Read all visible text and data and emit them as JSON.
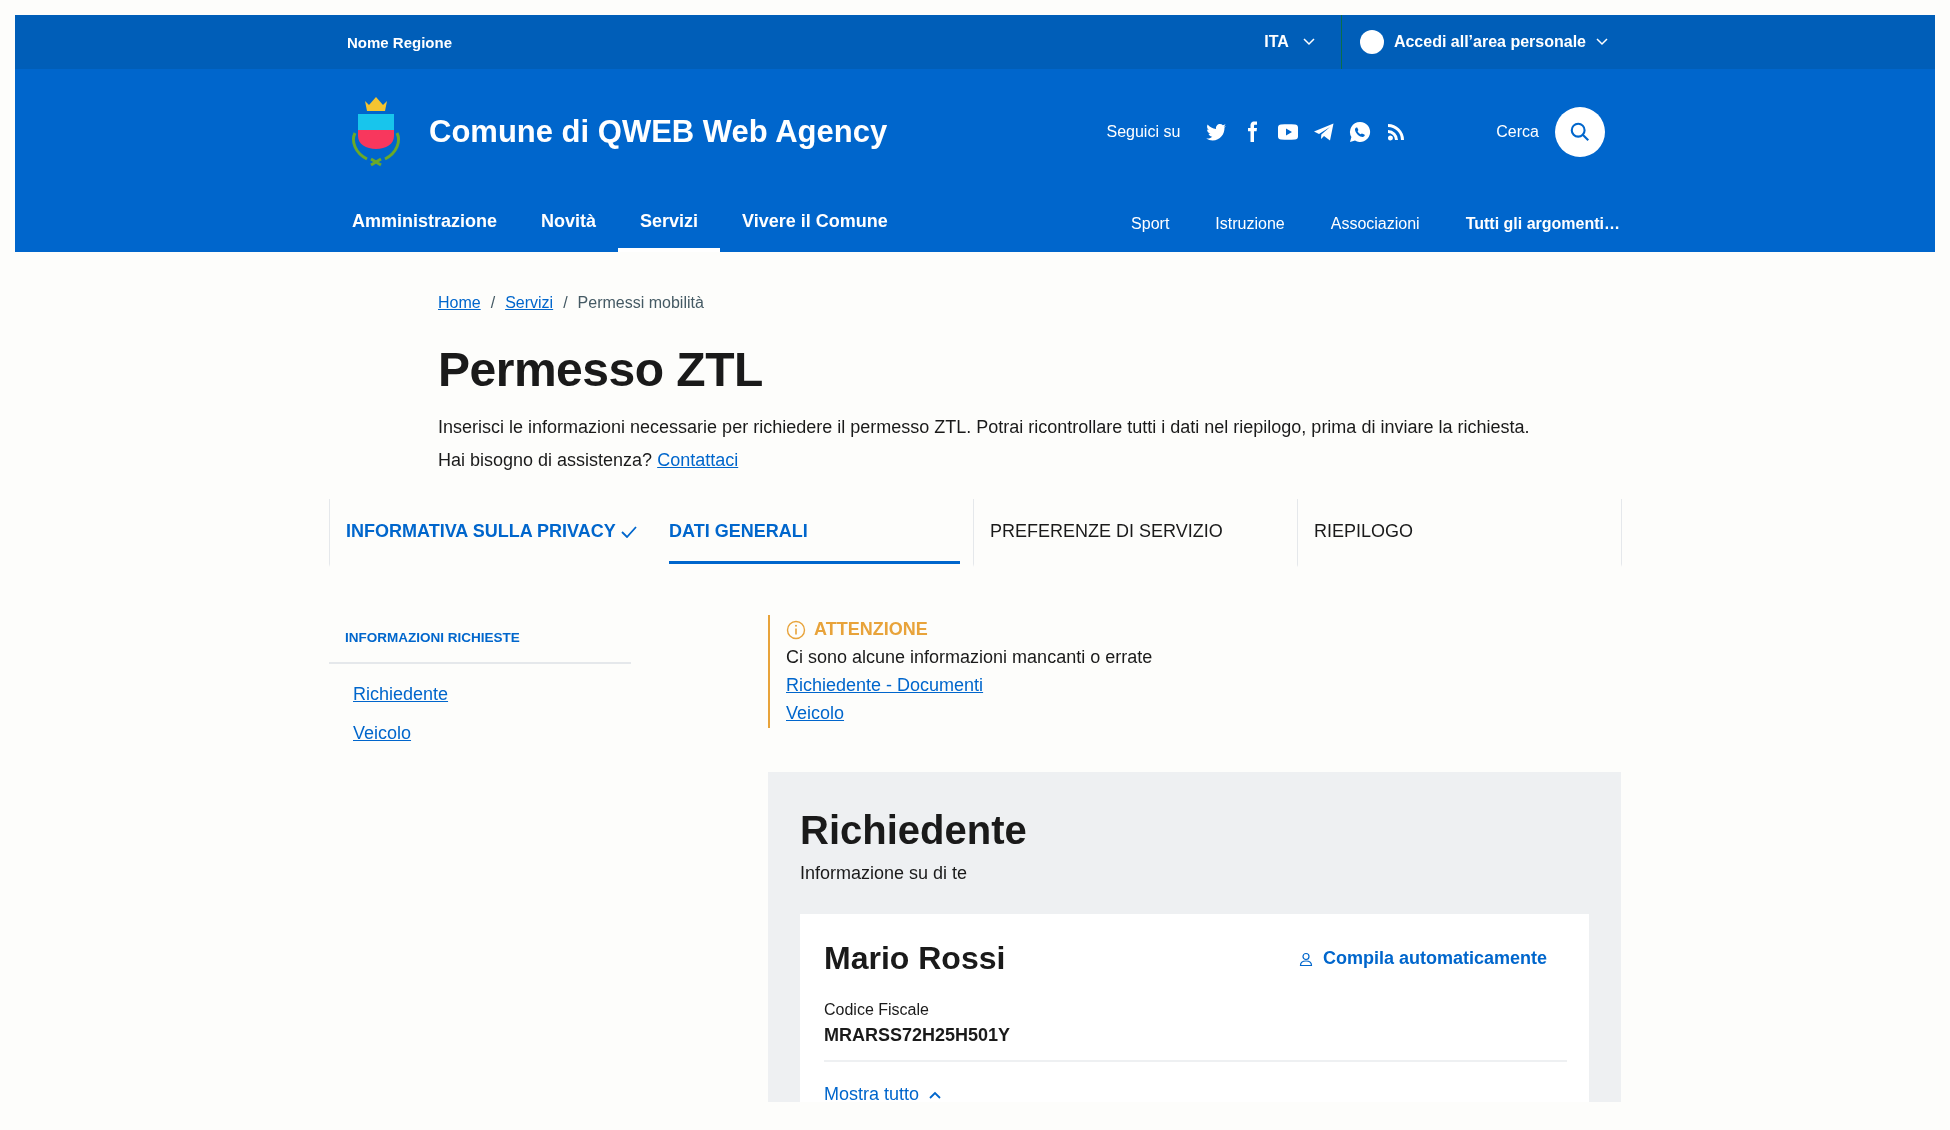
{
  "top_bar": {
    "region": "Nome Regione",
    "language": "ITA",
    "login": "Accedi all’area personale"
  },
  "header": {
    "title": "Comune di QWEB Web Agency",
    "follow_label": "Seguici su",
    "social": [
      {
        "kind": "twitter"
      },
      {
        "kind": "facebook"
      },
      {
        "kind": "youtube"
      },
      {
        "kind": "telegram"
      },
      {
        "kind": "whatsapp"
      },
      {
        "kind": "rss"
      }
    ],
    "search_label": "Cerca"
  },
  "main_nav": [
    {
      "label": "Amministrazione",
      "selected": false
    },
    {
      "label": "Novità",
      "selected": false
    },
    {
      "label": "Servizi",
      "selected": true
    },
    {
      "label": "Vivere il Comune",
      "selected": false
    }
  ],
  "topic_nav": [
    {
      "label": "Sport",
      "bold": false
    },
    {
      "label": "Istruzione",
      "bold": false
    },
    {
      "label": "Associazioni",
      "bold": false
    },
    {
      "label": "Tutti gli argomenti…",
      "bold": true
    }
  ],
  "breadcrumb": [
    {
      "label": "Home",
      "link": true
    },
    {
      "separator": "/",
      "label": "Servizi",
      "link": true
    },
    {
      "separator": "/",
      "label": "Permessi mobilità",
      "link": false
    }
  ],
  "page": {
    "title": "Permesso ZTL",
    "description": "Inserisci le informazioni necessarie per richiedere il permesso ZTL. Potrai ricontrollare tutti i dati nel riepilogo, prima di inviare la richiesta.",
    "help_text": "Hai bisogno di assistenza?",
    "help_link": "Contattaci"
  },
  "steps": [
    {
      "label": "INFORMATIVA SULLA PRIVACY",
      "selected": false,
      "done": true
    },
    {
      "label": "DATI GENERALI",
      "selected": true,
      "done": false
    },
    {
      "label": "PREFERENZE DI SERVIZIO",
      "selected": false,
      "done": false
    },
    {
      "label": "RIEPILOGO",
      "selected": false,
      "done": false
    }
  ],
  "sidebar": {
    "title": "INFORMAZIONI RICHIESTE",
    "items": [
      "Richiedente",
      "Veicolo"
    ]
  },
  "alert": {
    "title": "ATTENZIONE",
    "message": "Ci sono alcune informazioni mancanti o errate",
    "links": [
      "Richiedente - Documenti",
      "Veicolo"
    ]
  },
  "section": {
    "title": "Richiedente",
    "subtitle": "Informazione su di te",
    "card": {
      "name": "Mario Rossi",
      "autofill": "Compila automaticamente",
      "field_label": "Codice Fiscale",
      "field_value": "MRARSS72H25H501Y",
      "toggle": "Mostra tutto",
      "expanded": true
    }
  }
}
